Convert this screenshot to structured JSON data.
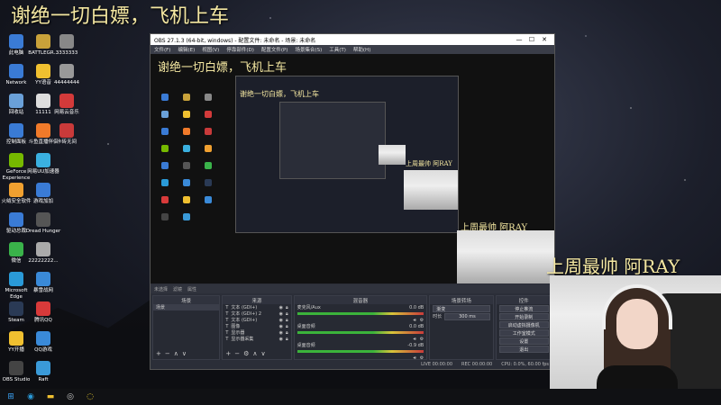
{
  "overlay": {
    "title": "谢绝一切白嫖，飞机上车",
    "streamer_name": "上周最帅 阿RAY"
  },
  "desktop_icons": [
    {
      "label": "此电脑",
      "icon": "computer-icon",
      "color": "#3a7bd5"
    },
    {
      "label": "BATTLEGR...",
      "icon": "game-icon",
      "color": "#c9a23a"
    },
    {
      "label": "3333333",
      "icon": "file-icon",
      "color": "#888888"
    },
    {
      "label": "Network",
      "icon": "network-icon",
      "color": "#3a7bd5"
    },
    {
      "label": "YY语音",
      "icon": "yy-icon",
      "color": "#f0c030"
    },
    {
      "label": "44444444",
      "icon": "file-icon",
      "color": "#999999"
    },
    {
      "label": "回收站",
      "icon": "recycle-bin-icon",
      "color": "#6aa0d8"
    },
    {
      "label": "11111",
      "icon": "file-icon",
      "color": "#dddddd"
    },
    {
      "label": "网易云音乐",
      "icon": "music-icon",
      "color": "#d33a3a"
    },
    {
      "label": "控制面板",
      "icon": "control-panel-icon",
      "color": "#3a7bd5"
    },
    {
      "label": "斗鱼直播伴侣",
      "icon": "douyu-icon",
      "color": "#f07a2a"
    },
    {
      "label": "卡砖无间",
      "icon": "game-icon",
      "color": "#c93a3a"
    },
    {
      "label": "GeForce Experience",
      "icon": "nvidia-icon",
      "color": "#76b900"
    },
    {
      "label": "网易UU加速器",
      "icon": "uu-icon",
      "color": "#3ab0e0"
    },
    {
      "label": "火绒安全软件",
      "icon": "shield-icon",
      "color": "#f0a030"
    },
    {
      "label": "游戏加加",
      "icon": "game-icon",
      "color": "#3a7bd5"
    },
    {
      "label": "驱动总裁",
      "icon": "driver-icon",
      "color": "#3a7bd5"
    },
    {
      "label": "Dread Hunger",
      "icon": "game-icon",
      "color": "#555555"
    },
    {
      "label": "微信",
      "icon": "wechat-icon",
      "color": "#3ab34a"
    },
    {
      "label": "22222222...",
      "icon": "file-icon",
      "color": "#aaaaaa"
    },
    {
      "label": "Microsoft Edge",
      "icon": "edge-icon",
      "color": "#2a9ad8"
    },
    {
      "label": "暴雪战网",
      "icon": "battlenet-icon",
      "color": "#3a8ad8"
    },
    {
      "label": "Steam",
      "icon": "steam-icon",
      "color": "#2a3a55"
    },
    {
      "label": "腾讯QQ",
      "icon": "qq-icon",
      "color": "#d83a3a"
    },
    {
      "label": "YY开播",
      "icon": "yy-icon",
      "color": "#f0c030"
    },
    {
      "label": "QQ游戏",
      "icon": "qq-game-icon",
      "color": "#3a8ad8"
    },
    {
      "label": "OBS Studio",
      "icon": "obs-icon",
      "color": "#444444"
    },
    {
      "label": "Raft",
      "icon": "game-icon",
      "color": "#3a9ad8"
    }
  ],
  "obs": {
    "window_title": "OBS 27.1.3 (64-bit, windows) - 配置文件: 未命名 - 场景: 未命名",
    "menu": [
      "文件(F)",
      "编辑(E)",
      "视图(V)",
      "停靠部件(D)",
      "配置文件(P)",
      "场景集合(S)",
      "工具(T)",
      "帮助(H)"
    ],
    "window_controls": [
      "—",
      "☐",
      "✕"
    ],
    "transitions_label": "未选择",
    "transition_tabs": [
      "滤镜",
      "属性"
    ],
    "docks": {
      "scenes": {
        "header": "场景",
        "items": [
          "场景"
        ]
      },
      "sources": {
        "header": "来源",
        "items": [
          "文本 (GDI+)",
          "文本 (GDI+) 2",
          "文本 (GDI+)",
          "图像",
          "显示器",
          "显示器采集"
        ]
      },
      "mixer": {
        "header": "混音器",
        "channels": [
          {
            "name": "麦克风/Aux",
            "db": "0.0 dB"
          },
          {
            "name": "桌面音频",
            "db": "0.0 dB"
          },
          {
            "name": "桌面音频",
            "db": "-0.9 dB"
          }
        ]
      },
      "transitions": {
        "header": "场景转场",
        "type": "渐变",
        "duration_label": "时长",
        "duration": "300 ms"
      },
      "controls": {
        "header": "控件",
        "buttons": [
          "停止推流",
          "开始录制",
          "启动虚拟摄像机",
          "工作室模式",
          "设置",
          "退出"
        ]
      }
    },
    "status": {
      "live_label": "LIVE",
      "live_time": "00:00:00",
      "rec_label": "REC",
      "rec_time": "00:00:00",
      "cpu": "CPU: 0.0%, 60.00 fps"
    }
  },
  "taskbar": [
    {
      "icon": "windows-start-icon",
      "glyph": "⊞",
      "color": "#3aa0f0"
    },
    {
      "icon": "edge-icon",
      "glyph": "◉",
      "color": "#2a9ad8"
    },
    {
      "icon": "file-explorer-icon",
      "glyph": "▬",
      "color": "#f0c030"
    },
    {
      "icon": "obs-icon",
      "glyph": "◎",
      "color": "#cccccc"
    },
    {
      "icon": "app-icon",
      "glyph": "◌",
      "color": "#f0d030"
    }
  ]
}
